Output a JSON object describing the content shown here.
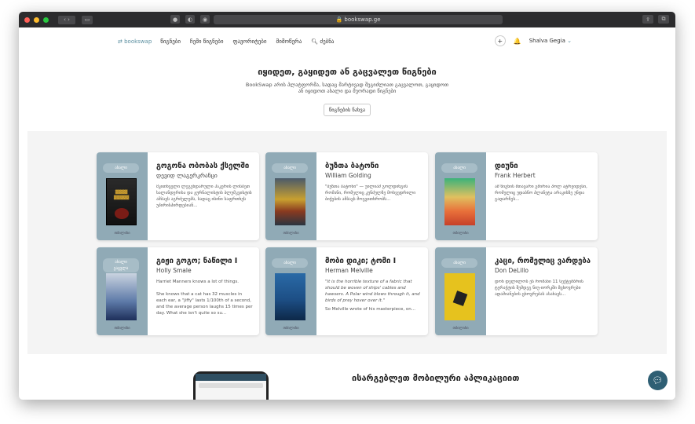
{
  "browser": {
    "url": "bookswap.ge",
    "colors": {
      "close": "#ff5f57",
      "min": "#febc2e",
      "max": "#28c840"
    }
  },
  "nav": {
    "logo": "bookswap",
    "links": [
      "წიგნები",
      "ჩემი წიგნები",
      "ფავორიტები",
      "მიმოწერა"
    ],
    "search": "ძებნა",
    "plus": "+",
    "bell": "🔔",
    "user": "Shalva Gegia"
  },
  "hero": {
    "title": "იყიდეთ, გაყიდეთ ან გაცვალეთ წიგნები",
    "line1": "BookSwap არის პლატფორმა, სადაც მარტივად შეგიძლიათ გაცვალოთ, გაყიდოთ",
    "line2": "ან იყიდოთ ახალი და მეორადი წიგნები",
    "button": "წიგნების ნახვა"
  },
  "cards": [
    {
      "tag": "ახალი",
      "title": "გოგონა ობობას ქსელში",
      "author": "დევიდ ლაგერკრანცი",
      "desc": "მკითხველი ლეგენდარული ჰაკერის ლისბეთ სალანდერისა და ჟურნალისტის ბლუმკვისტის ამბავს აგრძელებს, სადაც ისინი საფრთხეს უპირისპირდებიან...",
      "location": "თბილისი"
    },
    {
      "tag": "ახალი",
      "title": "ბუზთა ბატონი",
      "author": "William Golding",
      "desc": "\"ბუზთა ბატონი\" — უილიამ გოლდინგის რომანი, რომელიც კუნძულზე მოხვედრილი ბიჭების ამბავს მოგვითხრობს...",
      "location": "თბილისი"
    },
    {
      "tag": "ახალი",
      "title": "დიუნი",
      "author": "Frank Herbert",
      "desc": "ამ წიგნის მთავარი გმირია პოლ ატრეიდესი, რომელიც უდაბნო პლანეტა არაკისზე უნდა გადარჩეს...",
      "location": "თბილისი"
    },
    {
      "tag": "ახალი",
      "tag2": "გაცვლა",
      "title": "გიჟი გოგო; ნაწილი I",
      "author": "Holly Smale",
      "desc": "Harriet Manners knows a lot of things.\n\nShe knows that a cat has 32 muscles in each ear, a \"jiffy\" lasts 1/100th of a second, and the average person laughs 15 times per day. What she isn't quite so su...",
      "location": "თბილისი"
    },
    {
      "tag": "ახალი",
      "title": "მობი დიკი; ტომი I",
      "author": "Herman Melville",
      "desc": "\"It is the horrible texture of a fabric that should be woven of ships' cables and hawsers. A Polar wind blows through it, and birds of prey hover over it.\"",
      "desc2": "So Melville wrote of his masterpiece, on...",
      "location": "თბილისი"
    },
    {
      "tag": "ახალი",
      "title": "კაცი, რომელიც ვარდება",
      "author": "Don DeLillo",
      "desc": "დონ დელილოს ეს რომანი 11 სექტემბრის ტერაქტის შემდეგ ნიუ-იორკში მცხოვრები ადამიანების ცხოვრებას ასახავს...",
      "location": "თბილისი"
    }
  ],
  "bottom": {
    "title": "ისარგებლეთ მობილური აპლიკაციით",
    "chat_icon": "chat-bubble"
  }
}
